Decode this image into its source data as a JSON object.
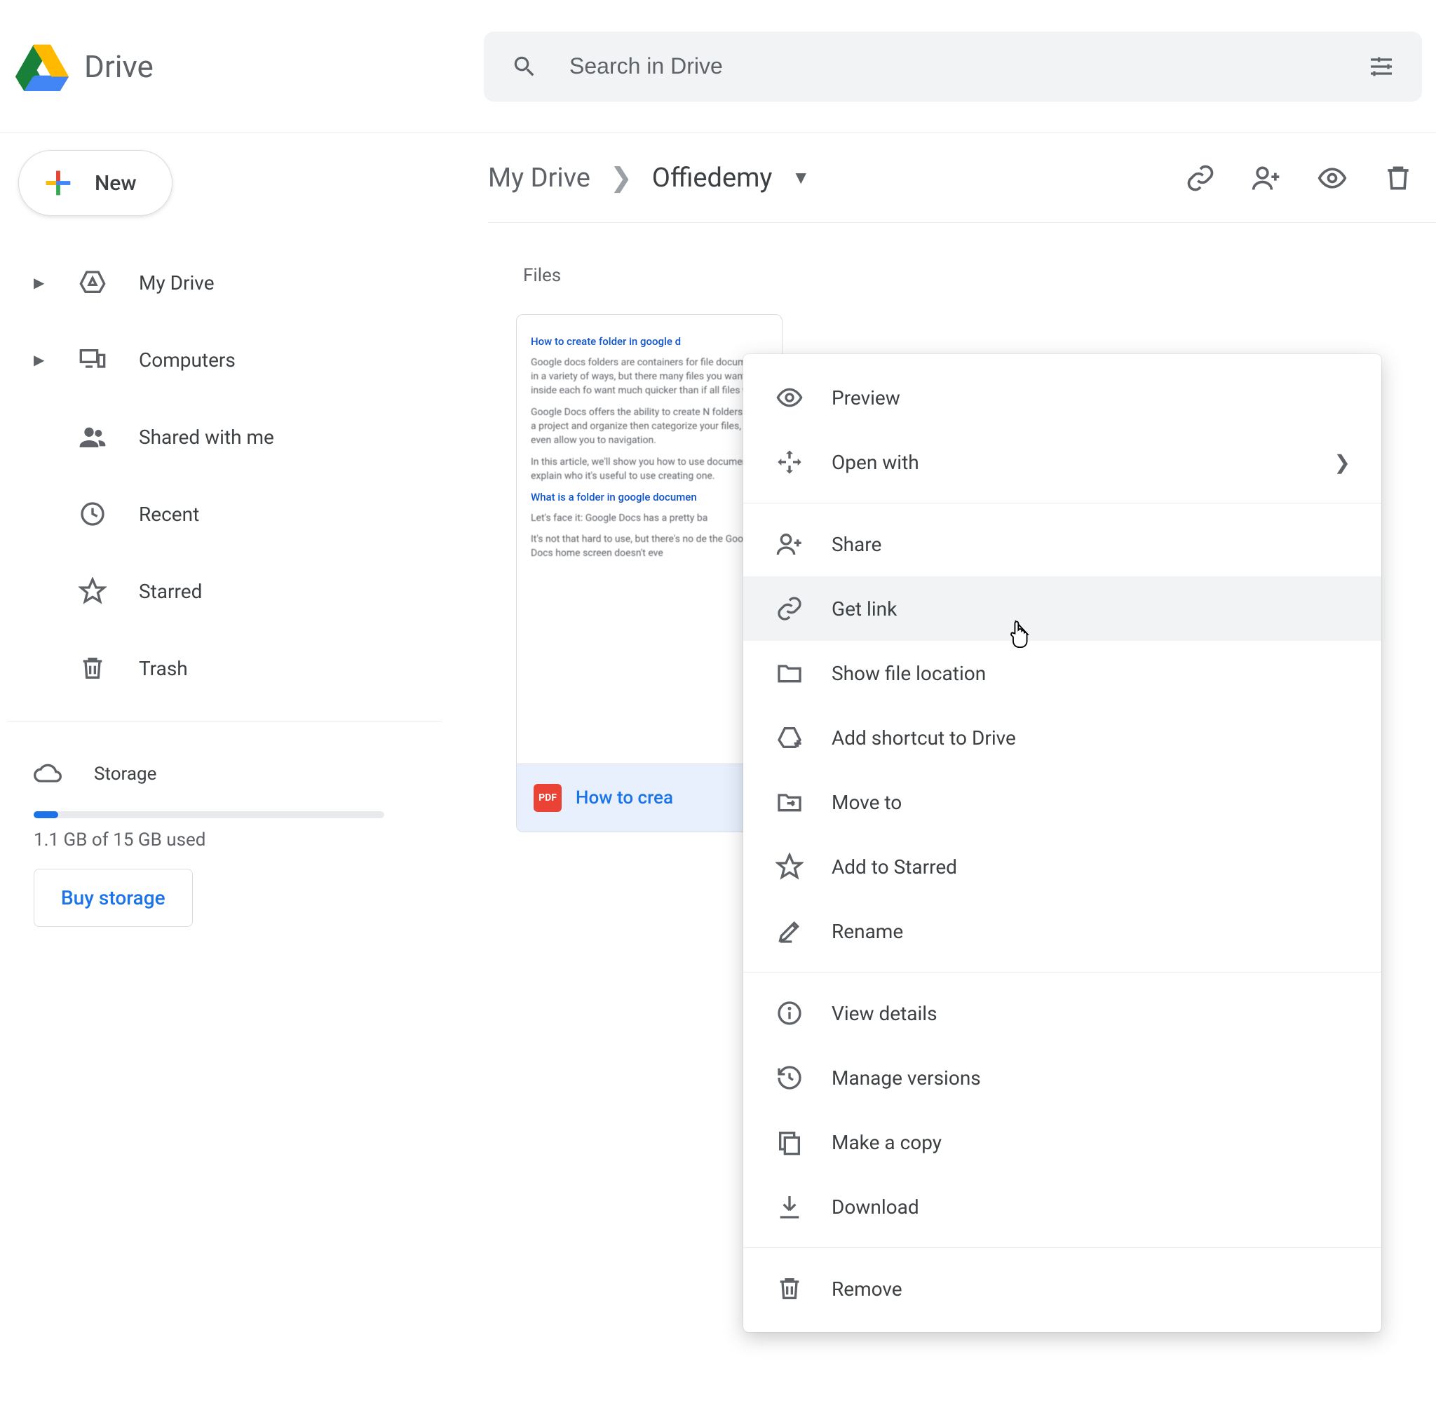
{
  "header": {
    "app_name": "Drive",
    "search_placeholder": "Search in Drive"
  },
  "sidebar": {
    "new_label": "New",
    "items": [
      {
        "label": "My Drive"
      },
      {
        "label": "Computers"
      },
      {
        "label": "Shared with me"
      },
      {
        "label": "Recent"
      },
      {
        "label": "Starred"
      },
      {
        "label": "Trash"
      }
    ],
    "storage": {
      "label": "Storage",
      "used_text": "1.1 GB of 15 GB used",
      "buy_label": "Buy storage"
    }
  },
  "breadcrumb": {
    "root": "My Drive",
    "current": "Offiedemy"
  },
  "main": {
    "section_label": "Files",
    "file_card": {
      "title": "How to crea",
      "badge": "PDF",
      "thumb_heading_1": "How to create folder in google d",
      "thumb_p1": "Google docs folders are containers for file documents in a variety of ways, but there many files you want to put inside each fo want much quicker than if all files were in",
      "thumb_p2": "Google Docs offers the ability to create N folders within a project and organize then categorize your files, or even allow you to navigation.",
      "thumb_p3": "In this article, we'll show you how to use documents, explain who it's useful to use creating one.",
      "thumb_heading_2": "What is a folder in google documen",
      "thumb_p4": "Let's face it: Google Docs has a pretty ba",
      "thumb_p5": "It's not that hard to use, but there's no de the Google Docs home screen doesn't eve"
    }
  },
  "context_menu": {
    "preview": "Preview",
    "open_with": "Open with",
    "share": "Share",
    "get_link": "Get link",
    "show_location": "Show file location",
    "add_shortcut": "Add shortcut to Drive",
    "move_to": "Move to",
    "add_starred": "Add to Starred",
    "rename": "Rename",
    "view_details": "View details",
    "manage_versions": "Manage versions",
    "make_copy": "Make a copy",
    "download": "Download",
    "remove": "Remove"
  }
}
